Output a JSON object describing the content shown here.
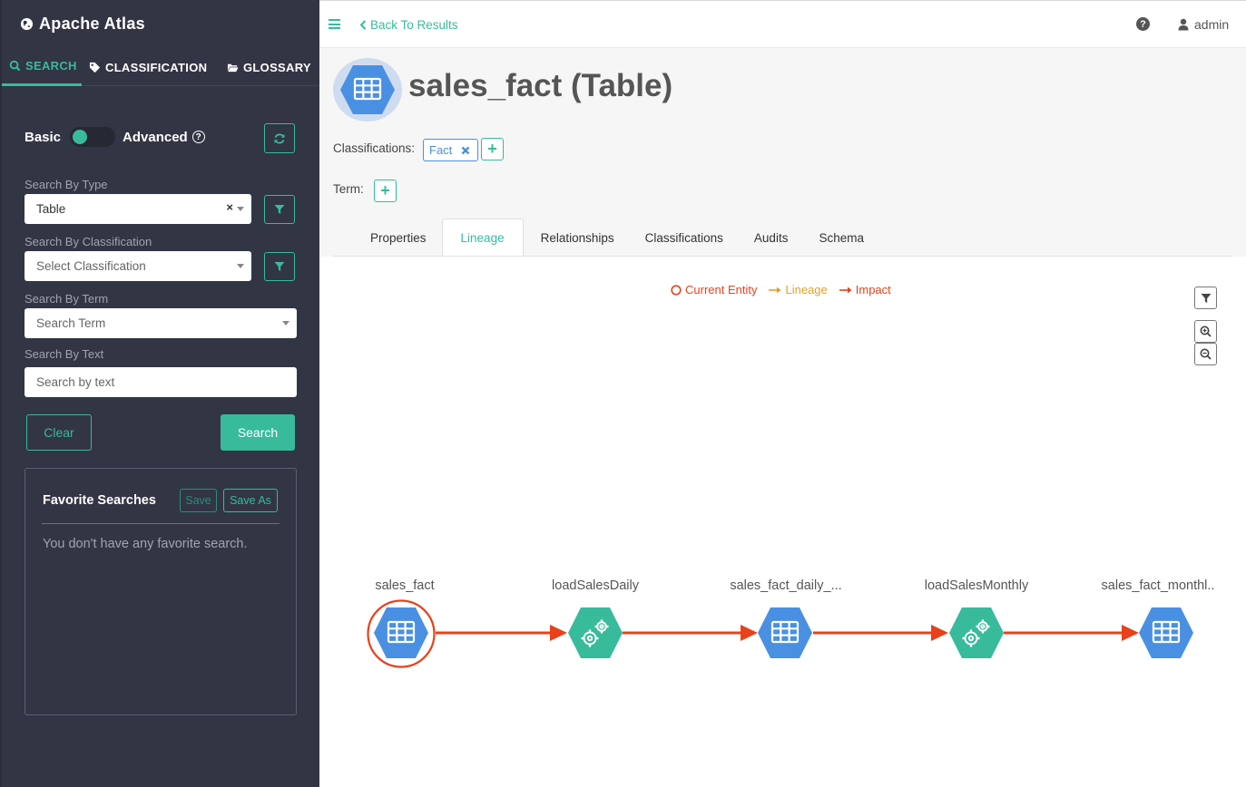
{
  "app": {
    "brand": "Apache Atlas"
  },
  "sidebar": {
    "tabs": [
      {
        "label": "SEARCH",
        "icon": "search-icon",
        "active": true
      },
      {
        "label": "CLASSIFICATION",
        "icon": "tags-icon",
        "active": false
      },
      {
        "label": "GLOSSARY",
        "icon": "folder-open-icon",
        "active": false
      }
    ],
    "toggle": {
      "left_label": "Basic",
      "right_label": "Advanced"
    },
    "search_by_type": {
      "label": "Search By Type",
      "value": "Table"
    },
    "search_by_classification": {
      "label": "Search By Classification",
      "placeholder": "Select Classification"
    },
    "search_by_term": {
      "label": "Search By Term",
      "placeholder": "Search Term"
    },
    "search_by_text": {
      "label": "Search By Text",
      "placeholder": "Search by text"
    },
    "clear_label": "Clear",
    "search_label": "Search",
    "favorites": {
      "title": "Favorite Searches",
      "save_label": "Save",
      "save_as_label": "Save As",
      "empty_text": "You don't have any favorite search."
    }
  },
  "topbar": {
    "back_label": "Back To Results",
    "user": "admin"
  },
  "entity": {
    "title": "sales_fact (Table)",
    "classifications_label": "Classifications:",
    "classification_tag": "Fact",
    "term_label": "Term:"
  },
  "tabs": [
    "Properties",
    "Lineage",
    "Relationships",
    "Classifications",
    "Audits",
    "Schema"
  ],
  "active_tab": "Lineage",
  "legend": {
    "current": "Current Entity",
    "lineage": "Lineage",
    "impact": "Impact"
  },
  "lineage": {
    "nodes": [
      {
        "label": "sales_fact",
        "kind": "table",
        "current": true
      },
      {
        "label": "loadSalesDaily",
        "kind": "process",
        "current": false
      },
      {
        "label": "sales_fact_daily_...",
        "kind": "table",
        "current": false
      },
      {
        "label": "loadSalesMonthly",
        "kind": "process",
        "current": false
      },
      {
        "label": "sales_fact_monthl..",
        "kind": "table",
        "current": false
      }
    ]
  },
  "colors": {
    "accent": "#37bb9b",
    "sidebar_bg": "#323544",
    "table_node": "#4a90e2",
    "process_node": "#37bb9b",
    "impact": "#e8411c",
    "lineage": "#e0a12a"
  }
}
